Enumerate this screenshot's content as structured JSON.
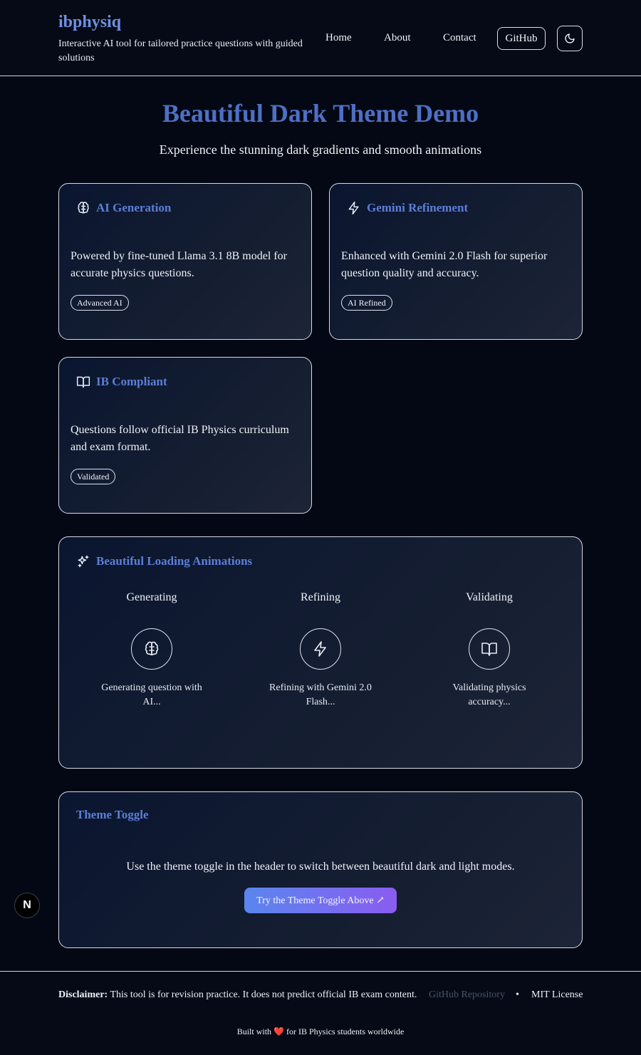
{
  "header": {
    "brand": "ibphysiq",
    "tagline": "Interactive AI tool for tailored practice questions with guided solutions",
    "nav": [
      "Home",
      "About",
      "Contact"
    ],
    "github_label": "GitHub",
    "theme_icon": "moon-icon"
  },
  "hero": {
    "title": "Beautiful Dark Theme Demo",
    "subtitle": "Experience the stunning dark gradients and smooth animations"
  },
  "features": [
    {
      "icon": "brain-icon",
      "title": "AI Generation",
      "description": "Powered by fine-tuned Llama 3.1 8B model for accurate physics questions.",
      "badge": "Advanced AI"
    },
    {
      "icon": "lightning-icon",
      "title": "Gemini Refinement",
      "description": "Enhanced with Gemini 2.0 Flash for superior question quality and accuracy.",
      "badge": "AI Refined"
    },
    {
      "icon": "book-icon",
      "title": "IB Compliant",
      "description": "Questions follow official IB Physics curriculum and exam format.",
      "badge": "Validated"
    }
  ],
  "animations": {
    "icon": "sparkles-icon",
    "title": "Beautiful Loading Animations",
    "steps": [
      {
        "label": "Generating",
        "icon": "brain-icon",
        "caption": "Generating question with AI..."
      },
      {
        "label": "Refining",
        "icon": "lightning-icon",
        "caption": "Refining with Gemini 2.0 Flash..."
      },
      {
        "label": "Validating",
        "icon": "book-icon",
        "caption": "Validating physics accuracy..."
      }
    ]
  },
  "theme_toggle": {
    "title": "Theme Toggle",
    "description": "Use the theme toggle in the header to switch between beautiful dark and light modes.",
    "button": "Try the Theme Toggle Above ↗"
  },
  "next_badge": "N",
  "footer": {
    "disclaimer_label": "Disclaimer:",
    "disclaimer_text": "This tool is for revision practice. It does not predict official IB exam content.",
    "github_repo": "GitHub Repository",
    "separator": "•",
    "license": "MIT License",
    "built_prefix": "Built with",
    "heart": "❤️",
    "built_suffix": "for IB Physics students worldwide"
  },
  "colors": {
    "background": "#040814",
    "accent": "#4e6fc4",
    "button_gradient_start": "#5a86ee",
    "button_gradient_end": "#8a5cf0"
  }
}
